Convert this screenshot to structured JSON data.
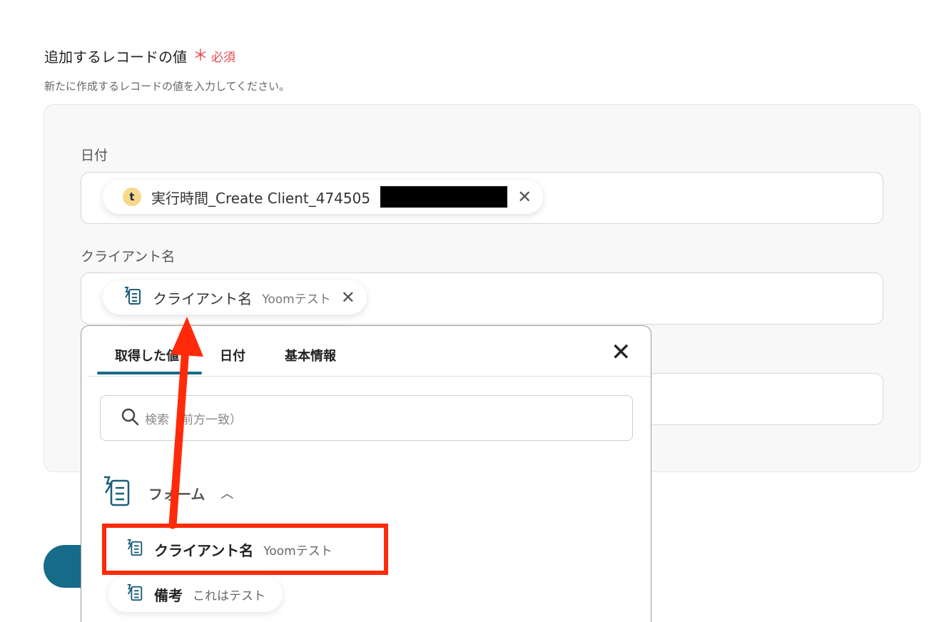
{
  "section": {
    "title": "追加するレコードの値",
    "required_mark": "＊",
    "required_label": "必須",
    "description": "新たに作成するレコードの値を入力してください。"
  },
  "fields": {
    "date_label": "日付",
    "date_chip_text": "実行時間_Create Client_474505",
    "date_chip_icon_letter": "t",
    "client_label": "クライアント名",
    "client_chip_text": "クライアント名",
    "client_chip_sub": "Yoomテスト"
  },
  "dropdown": {
    "tabs": [
      "取得した値",
      "日付",
      "基本情報"
    ],
    "search_placeholder": "検索（前方一致）",
    "group_label": "フォーム",
    "items": [
      {
        "label": "クライアント名",
        "sub": "Yoomテスト"
      },
      {
        "label": "備考",
        "sub": "これはテスト"
      }
    ]
  },
  "colors": {
    "accent": "#166b88",
    "required": "#e5484d",
    "annotation": "#ff2a0a"
  },
  "icons": {
    "close": "close-icon",
    "search": "search-icon",
    "form": "form-icon",
    "chevron": "chevron-up-icon"
  }
}
